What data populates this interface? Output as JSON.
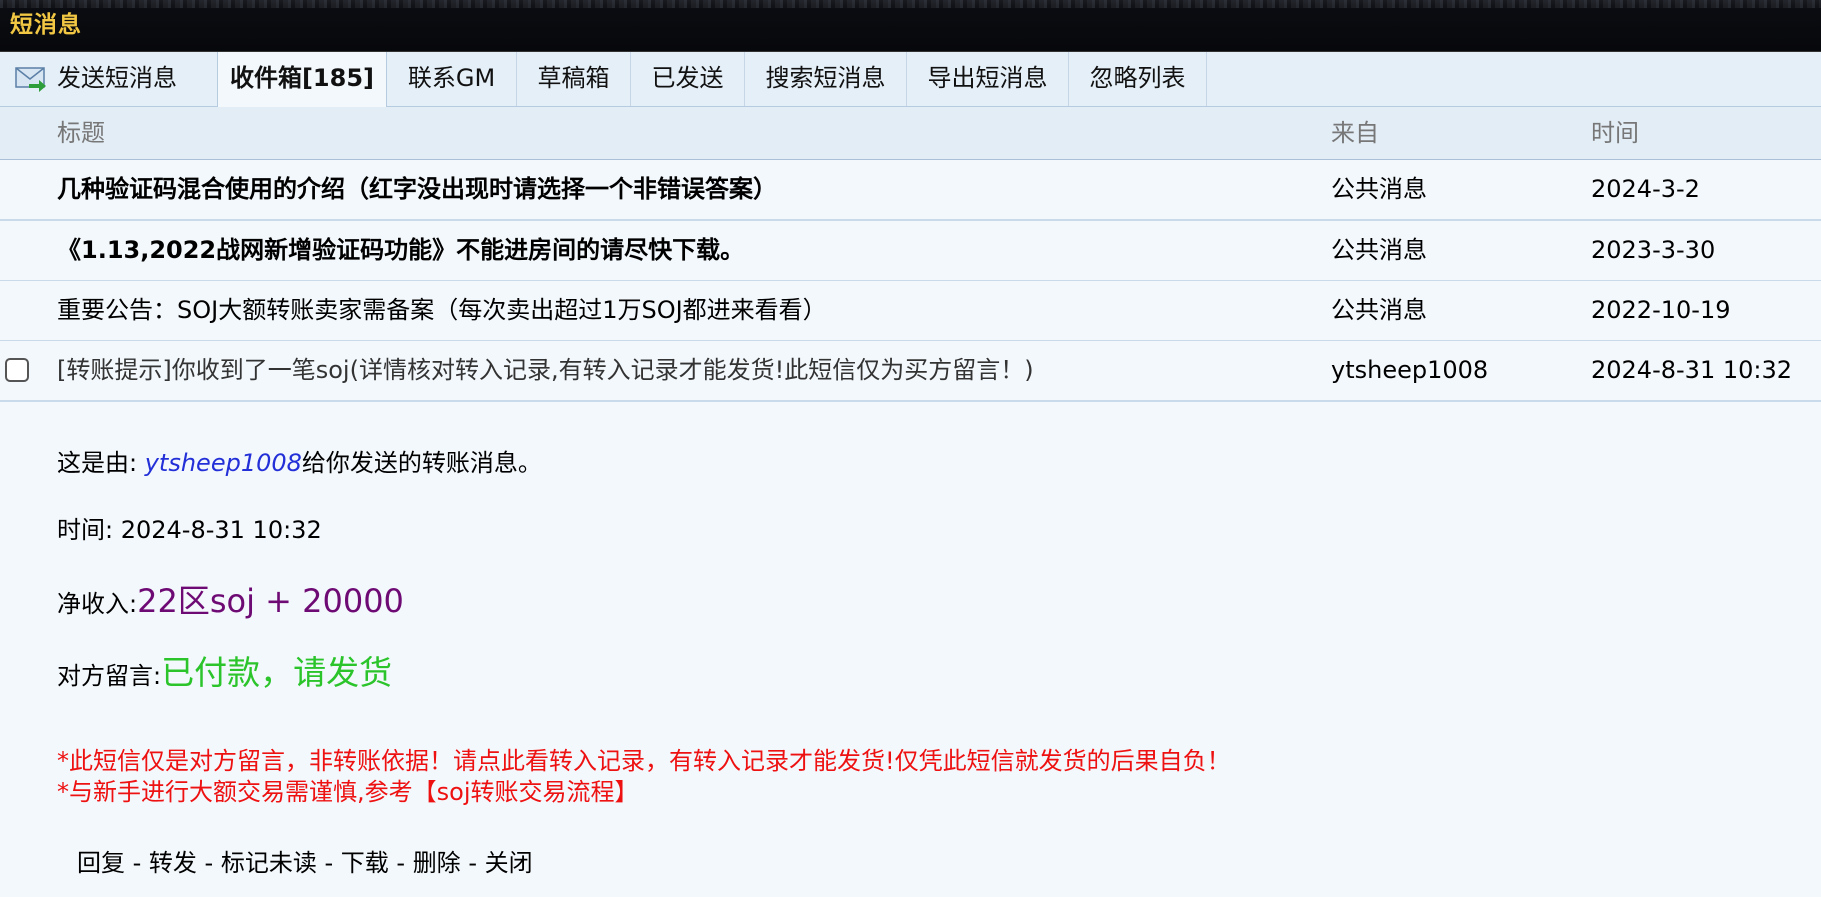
{
  "window": {
    "title": "短消息"
  },
  "tabs": {
    "send": "发送短消息",
    "inbox": "收件箱[185]",
    "contact_gm": "联系GM",
    "drafts": "草稿箱",
    "sent": "已发送",
    "search": "搜索短消息",
    "export": "导出短消息",
    "ignore": "忽略列表"
  },
  "table": {
    "headers": {
      "title": "标题",
      "from": "来自",
      "time": "时间"
    },
    "rows": [
      {
        "title": "几种验证码混合使用的介绍（红字没出现时请选择一个非错误答案）",
        "from": "公共消息",
        "time": "2024-3-2"
      },
      {
        "title": "《1.13,2022战网新增验证码功能》不能进房间的请尽快下载。",
        "from": "公共消息",
        "time": "2023-3-30"
      },
      {
        "title": "重要公告：SOJ大额转账卖家需备案（每次卖出超过1万SOJ都进来看看）",
        "from": "公共消息",
        "time": "2022-10-19"
      },
      {
        "title": "[转账提示]你收到了一笔soj(详情核对转入记录,有转入记录才能发货!此短信仅为买方留言！)",
        "from": "ytsheep1008",
        "time": "2024-8-31 10:32"
      }
    ]
  },
  "message": {
    "intro_prefix": "这是由: ",
    "sender": "ytsheep1008",
    "intro_suffix": "给你发送的转账消息。",
    "time_label": "时间: ",
    "time_value": "2024-8-31 10:32",
    "income_label": "净收入:",
    "income_value": "22区soj + 20000",
    "note_label": "对方留言:",
    "note_value": "已付款，请发货",
    "warning_1": "*此短信仅是对方留言，非转账依据！请点此看转入记录，有转入记录才能发货!仅凭此短信就发货的后果自负！",
    "warning_2": "*与新手进行大额交易需谨慎,参考【soj转账交易流程】"
  },
  "actions": {
    "reply": "回复",
    "forward": "转发",
    "mark_unread": "标记未读",
    "download": "下载",
    "delete": "删除",
    "close": "关闭",
    "separator": " - "
  },
  "colors": {
    "title_bar_text": "#f1c743",
    "sender_link": "#2330d8",
    "income": "#6e0a74",
    "note": "#2bc42b",
    "warning": "#ee1111"
  }
}
